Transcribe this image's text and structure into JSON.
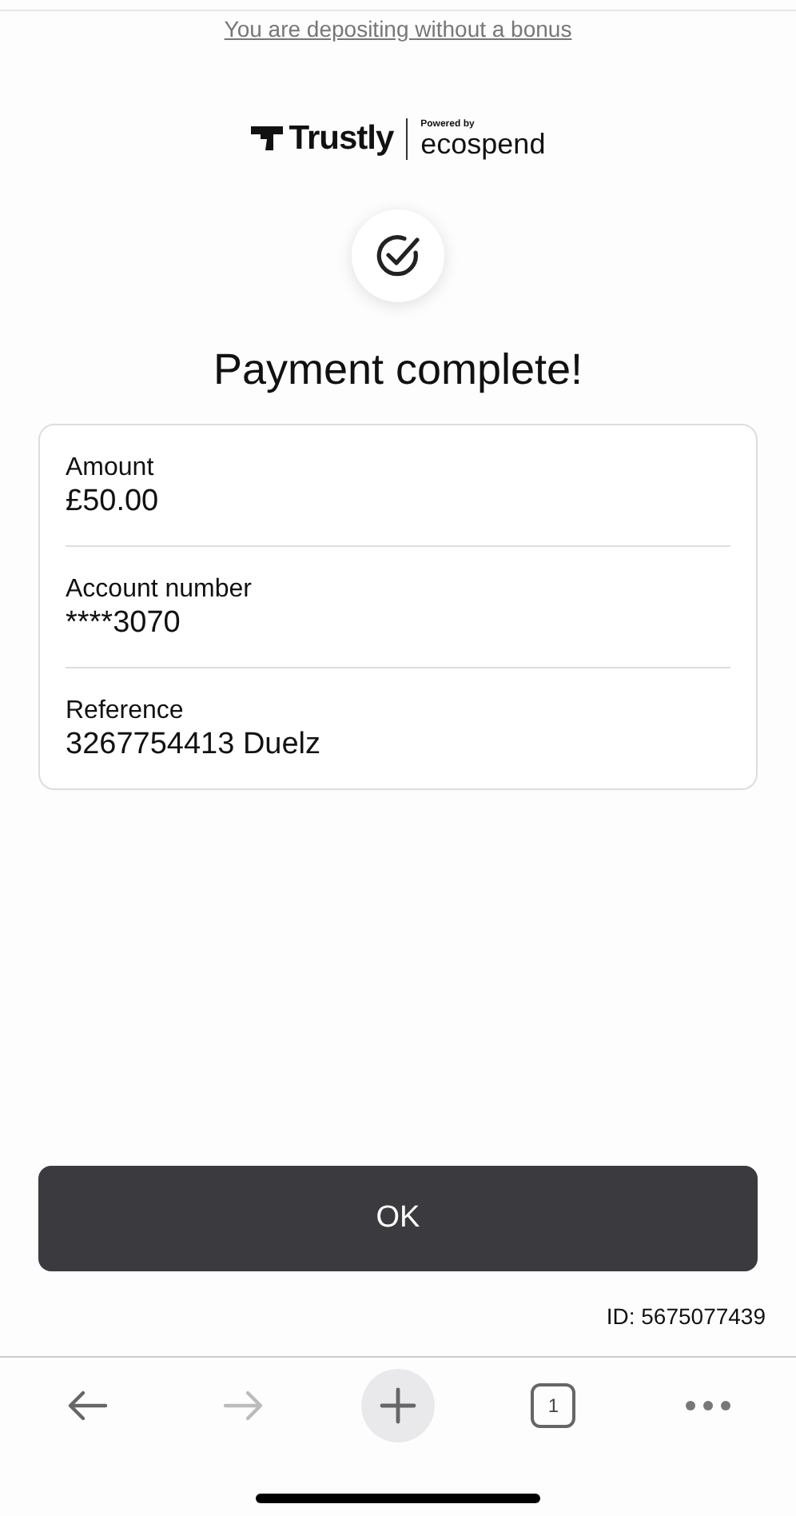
{
  "bonus_link": "You are depositing without a bonus",
  "logo": {
    "brand": "Trustly",
    "powered_by": "Powered by",
    "partner": "ecospend"
  },
  "title": "Payment complete!",
  "details": [
    {
      "label": "Amount",
      "value": "£50.00"
    },
    {
      "label": "Account number",
      "value": "****3070"
    },
    {
      "label": "Reference",
      "value": "3267754413 Duelz"
    }
  ],
  "ok_button": "OK",
  "id_text": "ID: 5675077439",
  "toolbar": {
    "back_disabled": false,
    "forward_disabled": true,
    "tab_count": "1"
  }
}
